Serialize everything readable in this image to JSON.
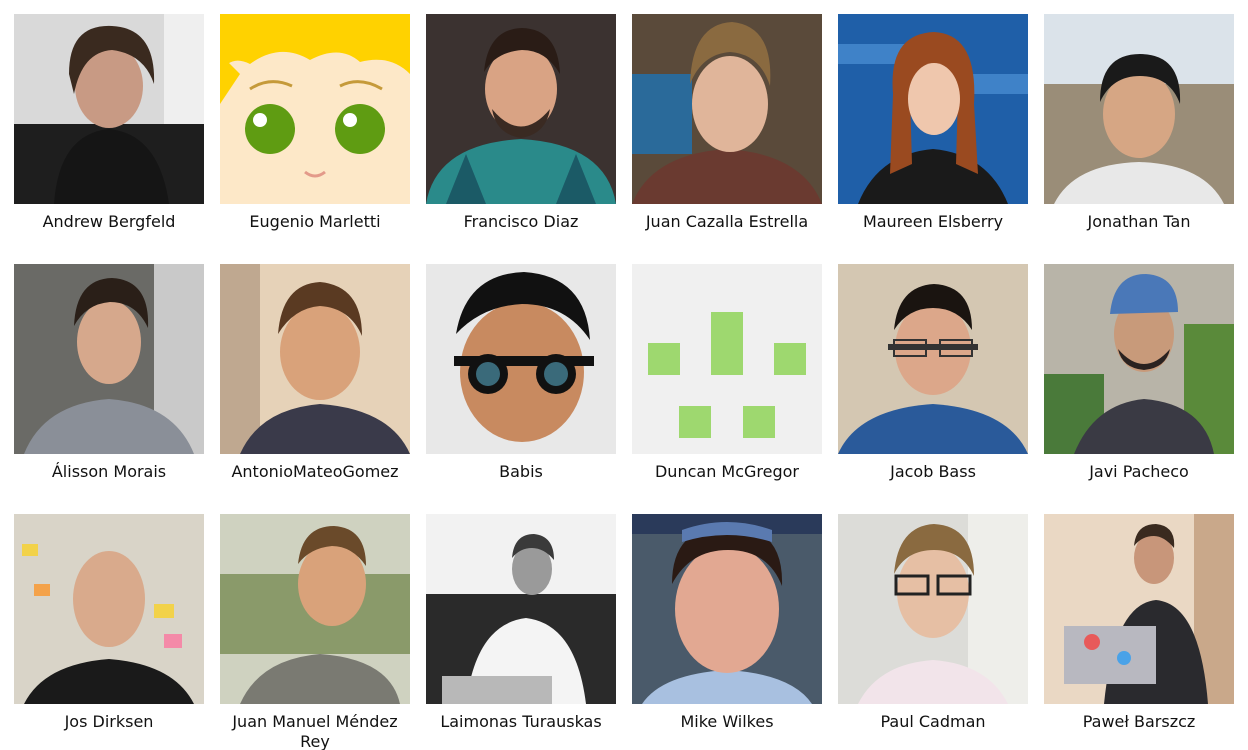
{
  "people": [
    {
      "name": "Andrew Bergfeld",
      "avatar": "photo-avatar"
    },
    {
      "name": "Eugenio Marletti",
      "avatar": "cartoon-avatar"
    },
    {
      "name": "Francisco Diaz",
      "avatar": "photo-avatar"
    },
    {
      "name": "Juan Cazalla Estrella",
      "avatar": "photo-avatar"
    },
    {
      "name": "Maureen Elsberry",
      "avatar": "photo-avatar"
    },
    {
      "name": "Jonathan Tan",
      "avatar": "photo-avatar"
    },
    {
      "name": "Álisson Morais",
      "avatar": "photo-avatar"
    },
    {
      "name": "AntonioMateoGomez",
      "avatar": "photo-avatar"
    },
    {
      "name": "Babis",
      "avatar": "photo-avatar"
    },
    {
      "name": "Duncan McGregor",
      "avatar": "identicon-avatar"
    },
    {
      "name": "Jacob Bass",
      "avatar": "photo-avatar"
    },
    {
      "name": "Javi Pacheco",
      "avatar": "photo-avatar"
    },
    {
      "name": "Jos Dirksen",
      "avatar": "photo-avatar"
    },
    {
      "name": "Juan Manuel Méndez Rey",
      "avatar": "photo-avatar"
    },
    {
      "name": "Laimonas Turauskas",
      "avatar": "photo-avatar"
    },
    {
      "name": "Mike Wilkes",
      "avatar": "photo-avatar"
    },
    {
      "name": "Paul Cadman",
      "avatar": "photo-avatar"
    },
    {
      "name": "Paweł Barszcz",
      "avatar": "photo-avatar"
    }
  ],
  "colors": {
    "identicon_fg": "#9ed86f",
    "identicon_bg": "#f0f0f0",
    "cartoon_skin": "#fde8c8",
    "cartoon_hair": "#ffd200",
    "cartoon_eye": "#5f9c12"
  }
}
